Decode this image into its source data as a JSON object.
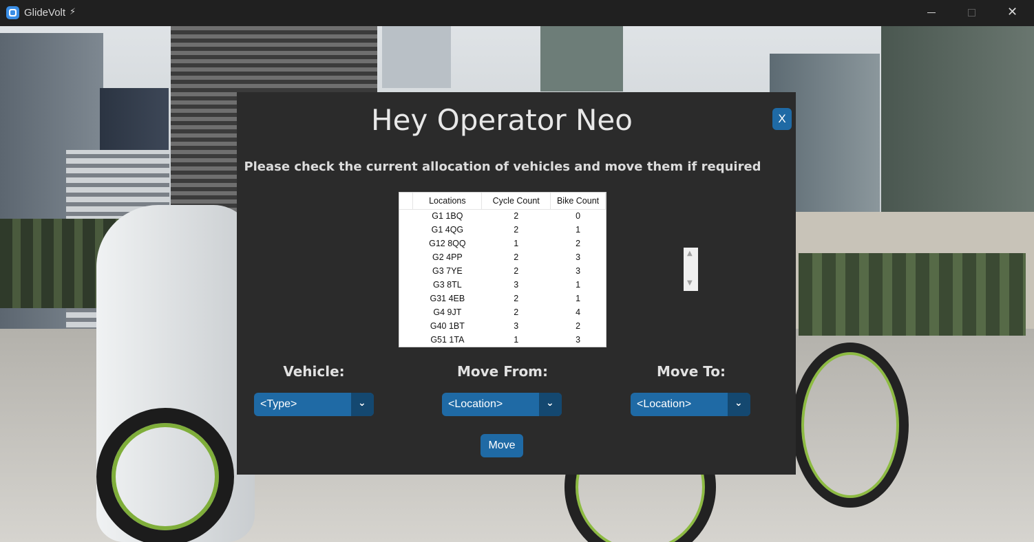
{
  "window": {
    "title": "GlideVolt",
    "title_icon": "bolt-icon",
    "bolt_glyph": "⚡",
    "close_glyph": "✕"
  },
  "dialog": {
    "greeting": "Hey Operator Neo",
    "close_label": "X",
    "instruction": "Please check the current allocation of vehicles and move them if required",
    "table": {
      "headers": [
        "Locations",
        "Cycle Count",
        "Bike Count"
      ],
      "rows": [
        [
          "G1 1BQ",
          "2",
          "0"
        ],
        [
          "G1 4QG",
          "2",
          "1"
        ],
        [
          "G12 8QQ",
          "1",
          "2"
        ],
        [
          "G2 4PP",
          "2",
          "3"
        ],
        [
          "G3 7YE",
          "2",
          "3"
        ],
        [
          "G3 8TL",
          "3",
          "1"
        ],
        [
          "G31 4EB",
          "2",
          "1"
        ],
        [
          "G4 9JT",
          "2",
          "4"
        ],
        [
          "G40 1BT",
          "3",
          "2"
        ],
        [
          "G51 1TA",
          "1",
          "3"
        ]
      ]
    },
    "vehicle_label": "Vehicle:",
    "vehicle_value": "<Type>",
    "move_from_label": "Move From:",
    "move_from_value": "<Location>",
    "move_to_label": "Move To:",
    "move_to_value": "<Location>",
    "move_button": "Move"
  },
  "colors": {
    "dialog_bg": "#2b2b2b",
    "accent": "#1f6aa5",
    "accent_dark": "#144870",
    "titlebar": "#202020"
  }
}
